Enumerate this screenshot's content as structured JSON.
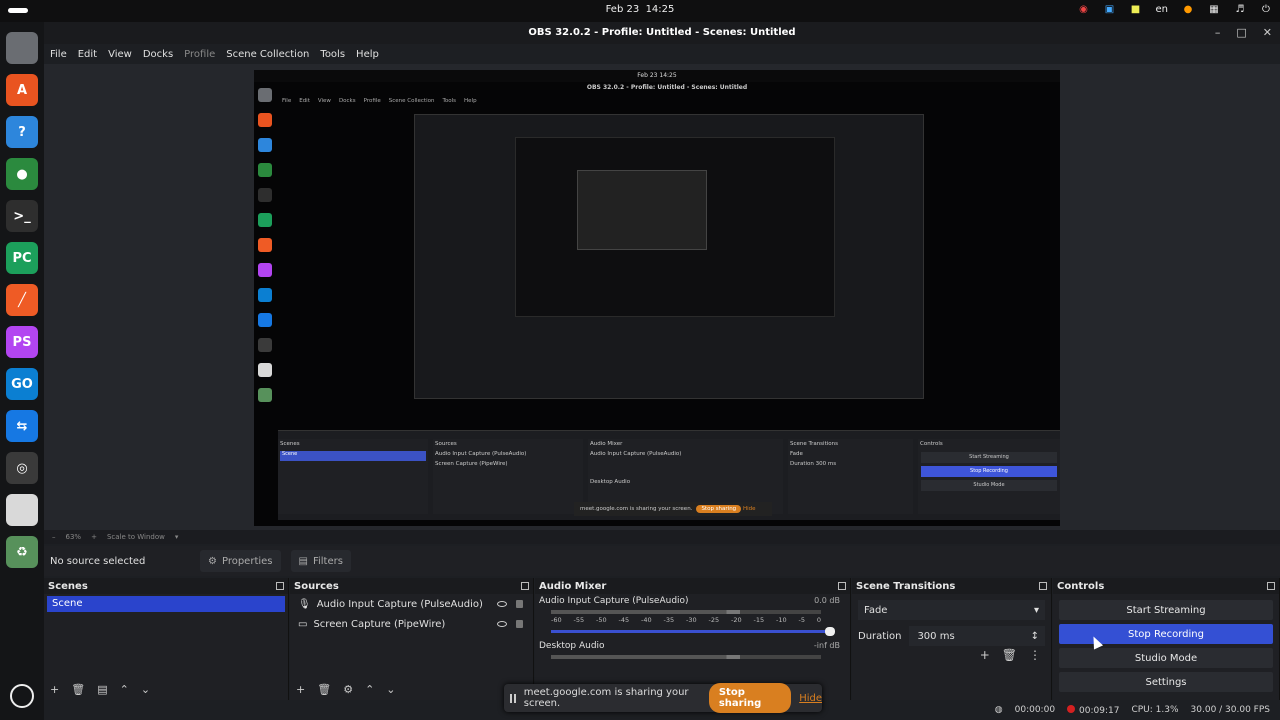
{
  "system": {
    "date": "Feb 23",
    "time": "14:25",
    "lang": "en"
  },
  "window": {
    "title": "OBS 32.0.2 - Profile: Untitled - Scenes: Untitled"
  },
  "menu": [
    "File",
    "Edit",
    "View",
    "Docks",
    "Profile",
    "Scene Collection",
    "Tools",
    "Help"
  ],
  "dock_apps": [
    {
      "name": "files",
      "color": "#6a6d72",
      "label": ""
    },
    {
      "name": "app-center",
      "color": "#e95420",
      "label": "A"
    },
    {
      "name": "help",
      "color": "#2d86dc",
      "label": "?"
    },
    {
      "name": "chrome",
      "color": "#2b8a3e",
      "label": "●"
    },
    {
      "name": "terminal",
      "color": "#2e2e2e",
      "label": ">_"
    },
    {
      "name": "pycharm",
      "color": "#1c9f5b",
      "label": "PC"
    },
    {
      "name": "postman",
      "color": "#ef5b25",
      "label": "╱"
    },
    {
      "name": "phpstorm",
      "color": "#b345f1",
      "label": "PS"
    },
    {
      "name": "goland",
      "color": "#0b7fd2",
      "label": "GO"
    },
    {
      "name": "teamviewer",
      "color": "#1678e3",
      "label": "⇆"
    },
    {
      "name": "obs",
      "color": "#3a3a3a",
      "label": "◎"
    },
    {
      "name": "document-viewer",
      "color": "#d9d9d9",
      "label": ""
    },
    {
      "name": "trash",
      "color": "#57915b",
      "label": "♻"
    }
  ],
  "preview": {
    "zoom": "63%",
    "scale": "Scale to Window",
    "nested_share": "meet.google.com is sharing your screen.",
    "nested_stop": "Stop sharing",
    "nested_hide": "Hide"
  },
  "source_bar": {
    "no_source": "No source selected",
    "properties": "Properties",
    "filters": "Filters"
  },
  "scenes": {
    "title": "Scenes",
    "items": [
      "Scene"
    ]
  },
  "sources": {
    "title": "Sources",
    "items": [
      "Audio Input Capture (PulseAudio)",
      "Screen Capture (PipeWire)"
    ]
  },
  "mixer": {
    "title": "Audio Mixer",
    "tracks": [
      {
        "name": "Audio Input Capture (PulseAudio)",
        "db": "0.0 dB"
      },
      {
        "name": "Desktop Audio",
        "db": "-inf dB"
      }
    ],
    "ticks": [
      "-60",
      "-55",
      "-50",
      "-45",
      "-40",
      "-35",
      "-30",
      "-25",
      "-20",
      "-15",
      "-10",
      "-5",
      "0"
    ]
  },
  "transitions": {
    "title": "Scene Transitions",
    "selected": "Fade",
    "duration_label": "Duration",
    "duration_value": "300 ms"
  },
  "controls": {
    "title": "Controls",
    "buttons": [
      "Start Streaming",
      "Stop Recording",
      "Studio Mode",
      "Settings"
    ]
  },
  "status": {
    "stream_time": "00:00:00",
    "rec_time": "00:09:17",
    "cpu": "CPU: 1.3%",
    "fps": "30.00 / 30.00 FPS"
  },
  "share": {
    "text": "meet.google.com is sharing your screen.",
    "stop": "Stop sharing",
    "hide": "Hide"
  }
}
